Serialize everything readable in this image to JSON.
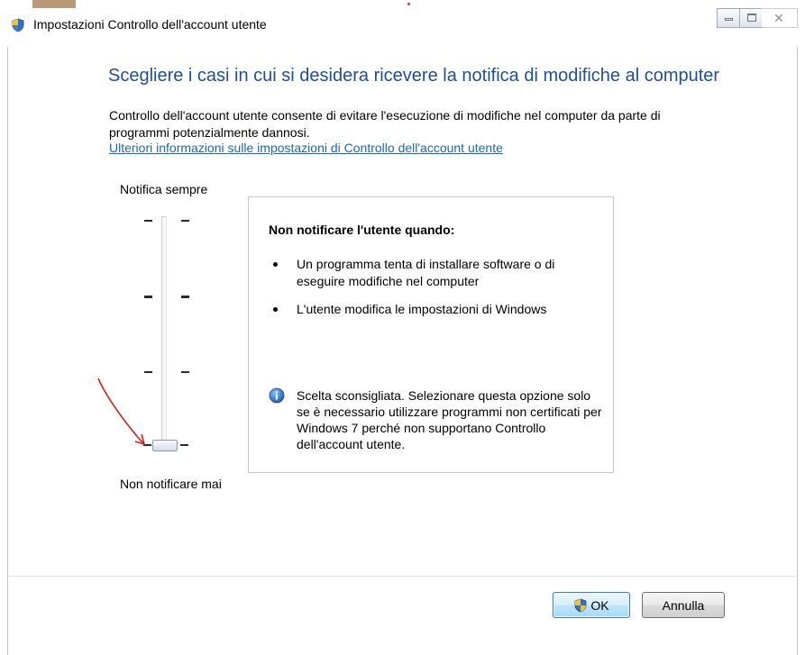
{
  "window": {
    "title": "Impostazioni Controllo dell'account utente",
    "icon": "uac-shield-icon",
    "controls": [
      "minimize-icon",
      "maximize-icon",
      "close-icon"
    ]
  },
  "main": {
    "heading": "Scegliere i casi in cui si desidera ricevere la notifica di modifiche al computer",
    "description": "Controllo dell'account utente consente di evitare l'esecuzione di modifiche nel computer da parte di programmi potenzialmente dannosi.",
    "link": "Ulteriori informazioni sulle impostazioni di Controllo dell'account utente"
  },
  "slider": {
    "top_label": "Notifica sempre",
    "bottom_label": "Non notificare mai",
    "levels": 4,
    "selected_level": 1,
    "selected_description": "lowest (Non notificare mai)"
  },
  "panel": {
    "title": "Non notificare l'utente quando:",
    "bullets": [
      "Un programma tenta di installare software o di eseguire modifiche nel computer",
      "L'utente modifica le impostazioni di Windows"
    ],
    "note_icon": "info-icon",
    "note": "Scelta sconsigliata. Selezionare questa opzione solo se è necessario utilizzare programmi non certificati per Windows 7 perché non supportano Controllo dell'account utente."
  },
  "footer": {
    "ok_label": "OK",
    "cancel_label": "Annulla"
  },
  "colors": {
    "heading": "#1e4f9c",
    "link": "#1a68b8",
    "annotation_arrow": "#d42020"
  }
}
